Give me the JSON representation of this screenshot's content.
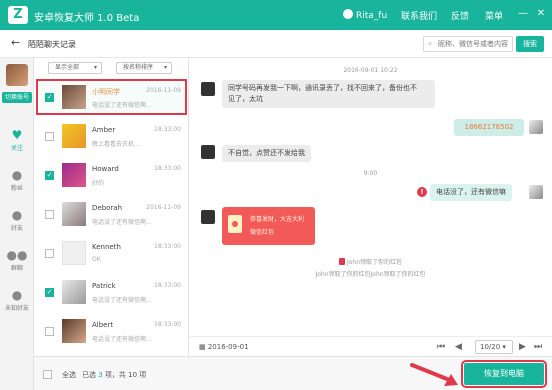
{
  "app": {
    "title": "安卓恢复大师 1.0 Beta",
    "logo": "Z"
  },
  "header": {
    "username": "Rita_fu",
    "menus": [
      "联系我们",
      "反馈",
      "菜单"
    ],
    "min_icon": "minimize-icon",
    "close_icon": "close-icon"
  },
  "crumb": {
    "title": "陌陌聊天记录"
  },
  "search": {
    "placeholder": "昵称、微信号或者内容",
    "button": "搜索"
  },
  "sidebar": {
    "account_button": "切换账号",
    "items": [
      {
        "label": "关注",
        "icon": "heart-icon",
        "active": true
      },
      {
        "label": "粉丝",
        "icon": "user-icon"
      },
      {
        "label": "好友",
        "icon": "friend-icon"
      },
      {
        "label": "群聊",
        "icon": "group-icon"
      },
      {
        "label": "未知好友",
        "icon": "unknown-user-icon"
      }
    ]
  },
  "filters": {
    "show": "显示全部",
    "sort": "按名称排序"
  },
  "contacts": [
    {
      "name": "小明同学",
      "msg": "电话没了还有微信啊...",
      "time": "2016-11-09",
      "checked": true,
      "selected": true
    },
    {
      "name": "Amber",
      "msg": "晚上看看去衣机...",
      "time": "18:33:00",
      "checked": false
    },
    {
      "name": "Howard",
      "msg": "好的",
      "time": "18:33:00",
      "checked": true
    },
    {
      "name": "Deborah",
      "msg": "电话没了还有微信啊...",
      "time": "2016-11-09",
      "checked": false
    },
    {
      "name": "Kenneth",
      "msg": "OK",
      "time": "18:33:00",
      "checked": false
    },
    {
      "name": "Patrick",
      "msg": "电话没了还有微信啊...",
      "time": "18:33:00",
      "checked": true
    },
    {
      "name": "Albert",
      "msg": "电话没了还有微信啊...",
      "time": "18:33:00",
      "checked": false
    }
  ],
  "chat": {
    "date1": "2016-09-01 10:22",
    "msg1": [
      "同学号码再发我一下啊，通讯录丢了，找不回来了，备份也不",
      "见了，太坑"
    ],
    "msg2": "18662178502",
    "msg3": "不自觉，点赞还不发给我",
    "time2": "9:00",
    "msg4": "电话没了，还有微信嘛",
    "alert_mark": "!",
    "redpacket": [
      "恭喜发财，大吉大利",
      "微信红包"
    ],
    "sys1": "John领取了你的红包",
    "sys2": "John领取了你的红包John领取了你的红包",
    "footer_date": "2016-09-01",
    "page": "10/20"
  },
  "bottom": {
    "all": "全选",
    "selected_prefix": "已选 ",
    "selected_count": "3",
    "selected_mid": " 项，共 ",
    "total": "10",
    "selected_suffix": " 项",
    "recover": "恢复到电脑"
  },
  "colors": {
    "accent": "#18b49b",
    "alert": "#e0394b"
  }
}
